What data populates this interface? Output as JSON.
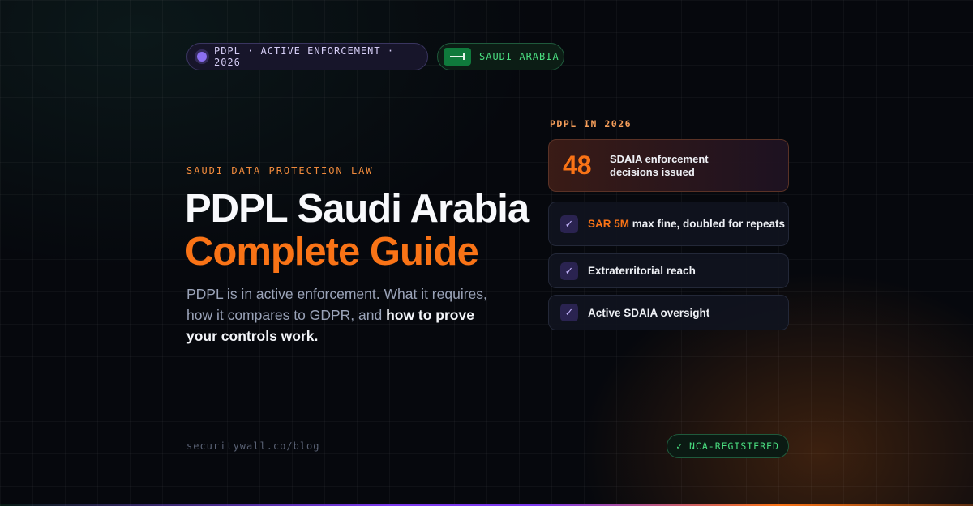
{
  "top_pills": {
    "enforcement_label": "PDPL · ACTIVE ENFORCEMENT · 2026",
    "country_label": "SAUDI ARABIA"
  },
  "hero": {
    "eyebrow": "SAUDI DATA PROTECTION LAW",
    "title_line1": "PDPL Saudi Arabia",
    "title_line2": "Complete Guide",
    "description_plain": "PDPL is in active enforcement. What it requires, how it compares to GDPR, and ",
    "description_bold": "how to prove your controls work."
  },
  "sidebar": {
    "label": "PDPL IN 2026",
    "stat": {
      "value": "48",
      "text": "SDAIA enforcement decisions issued"
    },
    "items": [
      {
        "highlight": "SAR 5M",
        "text": " max fine, doubled for repeats"
      },
      {
        "highlight": "",
        "text": "Extraterritorial reach"
      },
      {
        "highlight": "",
        "text": "Active SDAIA oversight"
      }
    ],
    "check_glyph": "✓"
  },
  "footer": {
    "url": "securitywall.co/blog",
    "badge_label": "NCA-REGISTERED",
    "badge_glyph": "✓"
  },
  "colors": {
    "accent_orange": "#f97316",
    "accent_purple": "#8b6ff0",
    "accent_green": "#4ade80",
    "background": "#06080d"
  },
  "icons": {
    "status_dot": "dot-icon",
    "flag": "saudi-flag-icon",
    "check": "check-icon"
  }
}
